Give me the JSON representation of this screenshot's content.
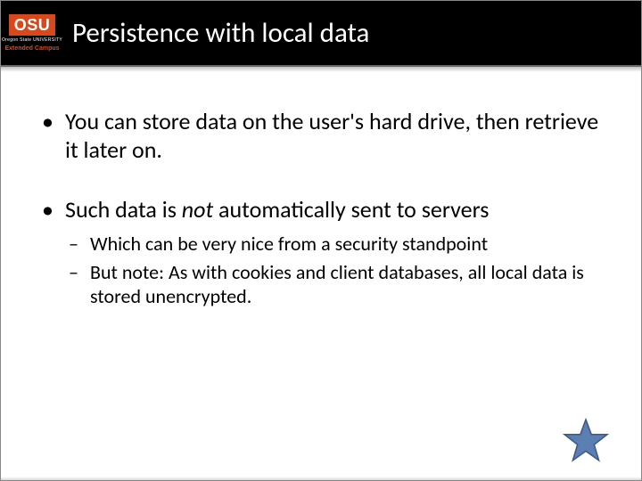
{
  "logo": {
    "main": "OSU",
    "sub": "Oregon State\nUNIVERSITY",
    "ext": "Extended Campus"
  },
  "title": "Persistence with local data",
  "bullets": [
    {
      "text": "You can store data on the user's hard drive, then retrieve it later on.",
      "sub": []
    },
    {
      "text_pre": "Such data is ",
      "text_em": "not",
      "text_post": " automatically sent to servers",
      "sub": [
        "Which can be very nice from a security standpoint",
        "But note: As with cookies and client databases, all local data is stored unencrypted."
      ]
    }
  ],
  "colors": {
    "brand": "#d7481d",
    "star_fill": "#5b7fb3",
    "star_stroke": "#3d5a86"
  }
}
